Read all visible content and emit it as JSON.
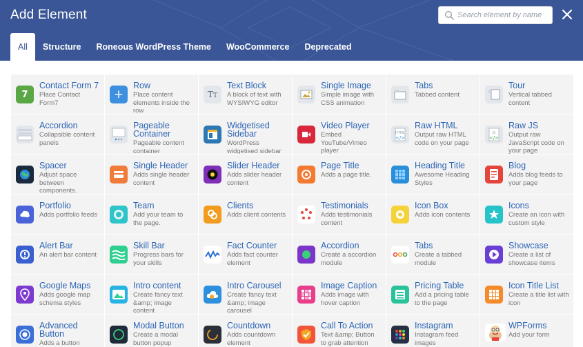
{
  "title": "Add Element",
  "search": {
    "placeholder": "Search element by name"
  },
  "tabs": [
    {
      "label": "All",
      "active": true
    },
    {
      "label": "Structure"
    },
    {
      "label": "Roneous WordPress Theme"
    },
    {
      "label": "WooCommerce"
    },
    {
      "label": "Deprecated"
    }
  ],
  "elements": [
    {
      "name": "Contact Form 7",
      "desc": "Place Contact Form7",
      "icon": "contact-form-7-icon",
      "color": "#5aa845",
      "glyph": "7"
    },
    {
      "name": "Row",
      "desc": "Place content elements inside the row",
      "icon": "row-plus-icon",
      "color": "#3d8fe0",
      "glyph": "+"
    },
    {
      "name": "Text Block",
      "desc": "A block of text with WYSIWYG editor",
      "icon": "text-block-icon",
      "color": "#e3e7ec",
      "glyph": "TT"
    },
    {
      "name": "Single Image",
      "desc": "Simple image with CSS animation",
      "icon": "single-image-icon",
      "color": "#e3e7ec",
      "glyph": ""
    },
    {
      "name": "Tabs",
      "desc": "Tabbed content",
      "icon": "tabs-icon",
      "color": "#e3e7ec",
      "glyph": ""
    },
    {
      "name": "Tour",
      "desc": "Vertical tabbed content",
      "icon": "tour-icon",
      "color": "#e3e7ec",
      "glyph": ""
    },
    {
      "name": "Accordion",
      "desc": "Collapsible content panels",
      "icon": "accordion-icon",
      "color": "#e3e7ec",
      "glyph": ""
    },
    {
      "name": "Pageable Container",
      "desc": "Pageable content container",
      "icon": "pageable-container-icon",
      "color": "#e3e7ec",
      "glyph": ""
    },
    {
      "name": "Widgetised Sidebar",
      "desc": "WordPress widgetised sidebar",
      "icon": "widgetised-sidebar-icon",
      "color": "#2b78b5",
      "glyph": ""
    },
    {
      "name": "Video Player",
      "desc": "Embed YouTube/Vimeo player",
      "icon": "video-player-icon",
      "color": "#d9283c",
      "glyph": ""
    },
    {
      "name": "Raw HTML",
      "desc": "Output raw HTML code on your page",
      "icon": "raw-html-icon",
      "color": "#e3e7ec",
      "glyph": ""
    },
    {
      "name": "Raw JS",
      "desc": "Output raw JavaScript code on your page",
      "icon": "raw-js-icon",
      "color": "#e3e7ec",
      "glyph": ""
    },
    {
      "name": "Spacer",
      "desc": "Adjust space between components.",
      "icon": "spacer-globe-icon",
      "color": "#1a2b40",
      "glyph": ""
    },
    {
      "name": "Single Header",
      "desc": "Adds single header content",
      "icon": "single-header-icon",
      "color": "#f07c3a",
      "glyph": ""
    },
    {
      "name": "Slider Header",
      "desc": "Adds slider header content",
      "icon": "slider-header-icon",
      "color": "#7f2fb8",
      "glyph": ""
    },
    {
      "name": "Page Title",
      "desc": "Adds a page title.",
      "icon": "page-title-icon",
      "color": "#f57a31",
      "glyph": ""
    },
    {
      "name": "Heading Title",
      "desc": "Awesome Heading Styles",
      "icon": "heading-title-icon",
      "color": "#2a8fd8",
      "glyph": ""
    },
    {
      "name": "Blog",
      "desc": "Adds blog feeds to your page",
      "icon": "blog-icon",
      "color": "#e5443a",
      "glyph": ""
    },
    {
      "name": "Portfolio",
      "desc": "Adds portfolio feeds",
      "icon": "portfolio-icon",
      "color": "#4a63d8",
      "glyph": ""
    },
    {
      "name": "Team",
      "desc": "Add your team to the page.",
      "icon": "team-icon",
      "color": "#2ec4c8",
      "glyph": ""
    },
    {
      "name": "Clients",
      "desc": "Adds client contents",
      "icon": "clients-icon",
      "color": "#f29b1e",
      "glyph": ""
    },
    {
      "name": "Testimonials",
      "desc": "Adds testimonials content",
      "icon": "testimonials-icon",
      "color": "#ffffff",
      "glyph": ""
    },
    {
      "name": "Icon Box",
      "desc": "Adds icon contents",
      "icon": "icon-box-icon",
      "color": "#f5d23a",
      "glyph": ""
    },
    {
      "name": "Icons",
      "desc": "Create an icon with custom style",
      "icon": "icons-star-icon",
      "color": "#27c3c9",
      "glyph": ""
    },
    {
      "name": "Alert Bar",
      "desc": "An alert bar content",
      "icon": "alert-bar-icon",
      "color": "#3a5fd0",
      "glyph": ""
    },
    {
      "name": "Skill Bar",
      "desc": "Progress bars for your skills",
      "icon": "skill-bar-icon",
      "color": "#2fcf8f",
      "glyph": ""
    },
    {
      "name": "Fact Counter",
      "desc": "Adds fact counter element",
      "icon": "fact-counter-icon",
      "color": "#ffffff",
      "glyph": ""
    },
    {
      "name": "Accordion",
      "desc": "Create a accordion module",
      "icon": "accordion-module-icon",
      "color": "#7b35c9",
      "glyph": ""
    },
    {
      "name": "Tabs",
      "desc": "Create a tabbed module",
      "icon": "tabbed-module-icon",
      "color": "#ffffff",
      "glyph": ""
    },
    {
      "name": "Showcase",
      "desc": "Create a list of showcase items",
      "icon": "showcase-icon",
      "color": "#6a3fd6",
      "glyph": ""
    },
    {
      "name": "Google Maps",
      "desc": "Adds google map schema styles",
      "icon": "google-maps-icon",
      "color": "#7c3ad0",
      "glyph": ""
    },
    {
      "name": "Intro content",
      "desc": "Create fancy text &amp; image content",
      "icon": "intro-content-icon",
      "color": "#27b3e3",
      "glyph": ""
    },
    {
      "name": "Intro Carousel",
      "desc": "Create fancy text &amp; image carousel",
      "icon": "intro-carousel-icon",
      "color": "#2f8fdf",
      "glyph": ""
    },
    {
      "name": "Image Caption",
      "desc": "Adds image with hover caption",
      "icon": "image-caption-icon",
      "color": "#e83e8c",
      "glyph": ""
    },
    {
      "name": "Pricing Table",
      "desc": "Add a pricing table to the page",
      "icon": "pricing-table-icon",
      "color": "#29c29a",
      "glyph": ""
    },
    {
      "name": "Icon Title List",
      "desc": "Create a title list with icon",
      "icon": "icon-title-list-icon",
      "color": "#f58a2a",
      "glyph": ""
    },
    {
      "name": "Advanced Button",
      "desc": "Adds a button",
      "icon": "advanced-button-icon",
      "color": "#3a6fd8",
      "glyph": ""
    },
    {
      "name": "Modal Button",
      "desc": "Create a modal button popup",
      "icon": "modal-button-icon",
      "color": "#1e2a3a",
      "glyph": ""
    },
    {
      "name": "Countdown",
      "desc": "Adds countdown element",
      "icon": "countdown-icon",
      "color": "#2a2f3a",
      "glyph": ""
    },
    {
      "name": "Call To Action",
      "desc": "Text &amp; Button to grab attention",
      "icon": "call-to-action-icon",
      "color": "#f2553a",
      "glyph": ""
    },
    {
      "name": "Instagram",
      "desc": "Instagram feed images",
      "icon": "instagram-icon",
      "color": "#263042",
      "glyph": ""
    },
    {
      "name": "WPForms",
      "desc": "Add your form",
      "icon": "wpforms-icon",
      "color": "#ffffff",
      "glyph": ""
    }
  ]
}
